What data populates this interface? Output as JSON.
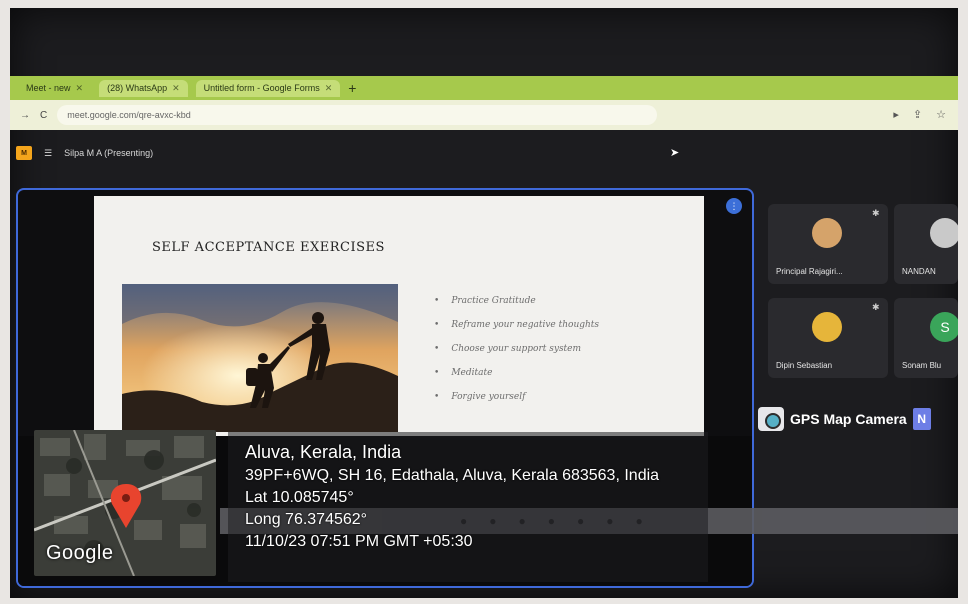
{
  "browser": {
    "tabs": [
      {
        "label": "Meet - new"
      },
      {
        "label": "(28) WhatsApp"
      },
      {
        "label": "Untitled form - Google Forms"
      }
    ],
    "address": "meet.google.com/qre-avxc-kbd"
  },
  "meet": {
    "presenter": "Silpa M A (Presenting)",
    "participants": [
      {
        "name": "Principal Rajagiri..."
      },
      {
        "name": "NANDAN"
      },
      {
        "name": "Dipin Sebastian"
      },
      {
        "name": "Sonam Blu"
      }
    ],
    "tile_initial_sonam": "S"
  },
  "slide": {
    "title": "SELF ACCEPTANCE EXERCISES",
    "bullets": [
      "Practice Gratitude",
      "Reframe your negative thoughts",
      "Choose your support system",
      "Meditate",
      "Forgive yourself"
    ]
  },
  "gps": {
    "camera_label": "GPS Map Camera",
    "badge": "N",
    "location": "Aluva, Kerala, India",
    "address": "39PF+6WQ, SH 16, Edathala, Aluva, Kerala 683563, India",
    "lat": "Lat 10.085745°",
    "long": "Long 76.374562°",
    "datetime": "11/10/23 07:51 PM GMT +05:30",
    "map_brand": "Google"
  },
  "colors": {
    "tabbar": "#a6c94c",
    "stage_border": "#3f69d9",
    "pin": "#e8442e"
  }
}
